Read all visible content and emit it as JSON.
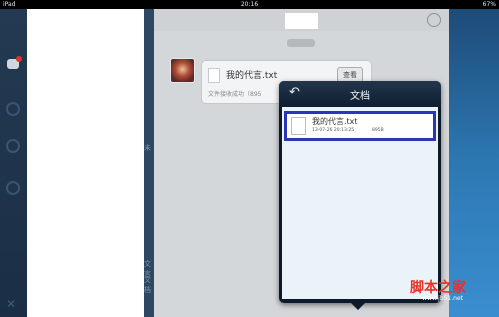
{
  "status_bar": {
    "device": "iPad",
    "time": "20:16",
    "battery": "67%"
  },
  "chat": {
    "bubble": {
      "file_name": "我的代言.txt",
      "view_label": "查看",
      "status_text": "文件接收成功（895"
    }
  },
  "list": {
    "snippets": [
      "未",
      "文言",
      "文档"
    ]
  },
  "popover": {
    "title": "文档",
    "back_icon": "undo-arrow-icon",
    "items": [
      {
        "name": "我的代言.txt",
        "date": "13-07-26 20:13:25",
        "size": "895B"
      }
    ]
  },
  "watermark": {
    "logo": "脚本之家",
    "url": "www.jb51.net"
  },
  "colors": {
    "selection_border": "#2a35b8",
    "popover_bg": "#0d1a2a",
    "list_bg": "#e9f3f8"
  }
}
